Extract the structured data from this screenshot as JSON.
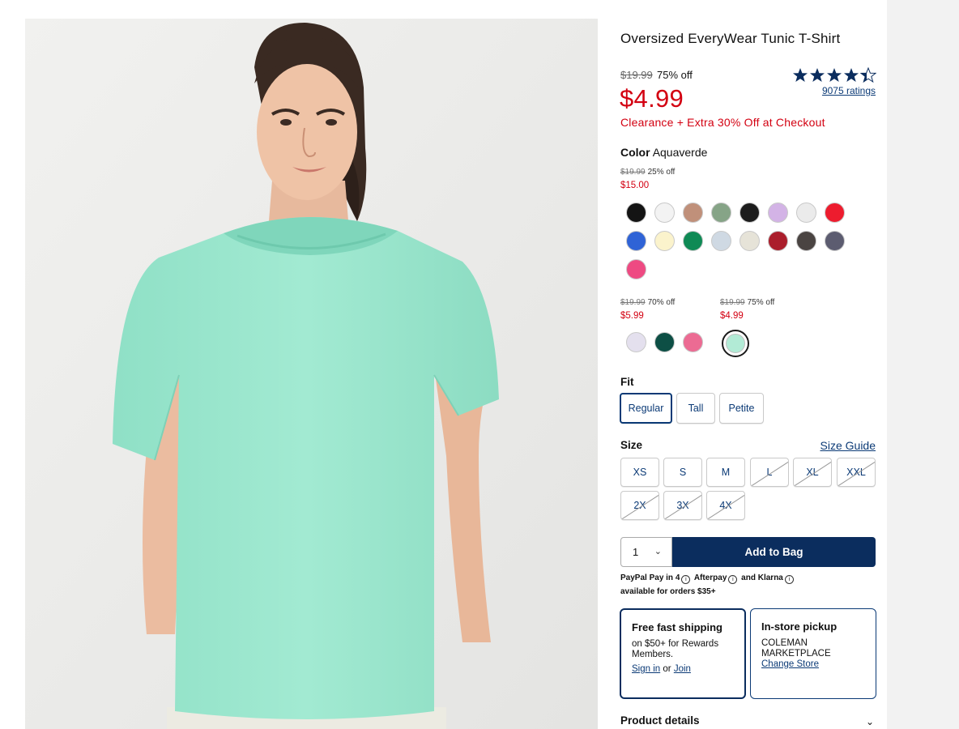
{
  "product": {
    "title": "Oversized EveryWear Tunic T-Shirt",
    "original_price": "$19.99",
    "discount": "75% off",
    "sale_price": "$4.99",
    "promo": "Clearance + Extra 30% Off at Checkout",
    "rating_value": 4.5,
    "ratings_label": "9075 ratings"
  },
  "color": {
    "label": "Color",
    "selected": "Aquaverde",
    "tiers": [
      {
        "original": "$19.99",
        "discount": "25% off",
        "price": "$15.00",
        "swatches": [
          {
            "name": "black",
            "hex": "#141414"
          },
          {
            "name": "white",
            "hex": "#f3f3f3"
          },
          {
            "name": "tan",
            "hex": "#c0907a"
          },
          {
            "name": "sage",
            "hex": "#86a487"
          },
          {
            "name": "black-2",
            "hex": "#1c1c1c"
          },
          {
            "name": "lavender",
            "hex": "#d3b3e6"
          },
          {
            "name": "light-gray",
            "hex": "#ebebeb"
          },
          {
            "name": "red",
            "hex": "#ed1c2e"
          },
          {
            "name": "royal-blue",
            "hex": "#2f63d6"
          },
          {
            "name": "cream",
            "hex": "#fbf3cc"
          },
          {
            "name": "green",
            "hex": "#0f8a55"
          },
          {
            "name": "light-blue",
            "hex": "#cfd9e3"
          },
          {
            "name": "oatmeal",
            "hex": "#e6e3d8"
          },
          {
            "name": "crimson",
            "hex": "#ab1e2c"
          },
          {
            "name": "charcoal",
            "hex": "#4a4442"
          },
          {
            "name": "slate",
            "hex": "#5c5c70"
          },
          {
            "name": "pink",
            "hex": "#ee4a82"
          }
        ]
      },
      {
        "original": "$19.99",
        "discount": "70% off",
        "price": "$5.99",
        "swatches": [
          {
            "name": "pale-lilac",
            "hex": "#e4e0ee"
          },
          {
            "name": "dark-teal",
            "hex": "#0d4f45"
          },
          {
            "name": "rose",
            "hex": "#ec6b93"
          }
        ]
      },
      {
        "original": "$19.99",
        "discount": "75% off",
        "price": "$4.99",
        "swatches": [
          {
            "name": "aquaverde",
            "hex": "#b2ebd6",
            "selected": true
          }
        ]
      }
    ]
  },
  "fit": {
    "label": "Fit",
    "options": [
      "Regular",
      "Tall",
      "Petite"
    ],
    "selected": "Regular"
  },
  "size": {
    "label": "Size",
    "guide_link": "Size Guide",
    "options": [
      "XS",
      "S",
      "M",
      "L",
      "XL",
      "XXL",
      "2X",
      "3X",
      "4X"
    ],
    "unavailable": [
      "L",
      "XL",
      "XXL",
      "2X",
      "3X",
      "4X"
    ]
  },
  "purchase": {
    "quantity": "1",
    "add_to_bag": "Add to Bag",
    "pay_line_1": "PayPal Pay in 4",
    "afterpay": "Afterpay",
    "and": "and",
    "klarna": "Klarna",
    "pay_line_2": "available for orders $35+"
  },
  "shipping": {
    "title": "Free fast shipping",
    "body": "on $50+ for Rewards Members.",
    "sign_in": "Sign in",
    "or": "or",
    "join": "Join"
  },
  "pickup": {
    "title": "In-store pickup",
    "store": "COLEMAN MARKETPLACE",
    "change": "Change Store"
  },
  "details": {
    "label": "Product details"
  },
  "colors": {
    "sale_red": "#d30011",
    "navy": "#0b2d5e",
    "link_blue": "#0b3a76",
    "shirt": "#9de7cf"
  }
}
